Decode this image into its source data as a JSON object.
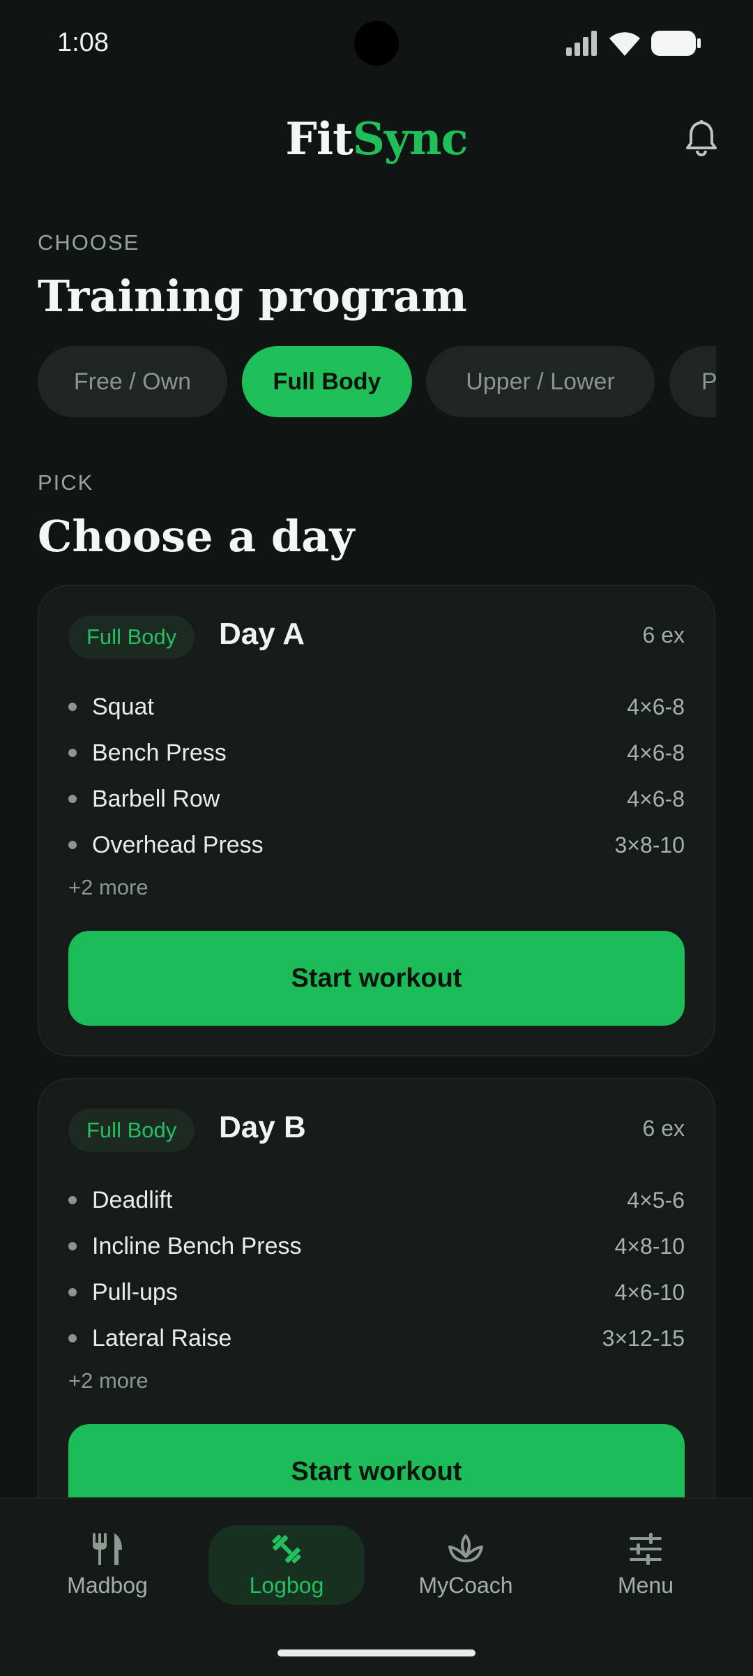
{
  "status_bar": {
    "time": "1:08"
  },
  "header": {
    "brand_part1": "Fit",
    "brand_part2": "Sync"
  },
  "program_section": {
    "eyebrow": "CHOOSE",
    "title": "Training program",
    "chips": [
      {
        "label": "Free / Own",
        "active": false
      },
      {
        "label": "Full Body",
        "active": true
      },
      {
        "label": "Upper / Lower",
        "active": false
      },
      {
        "label": "P",
        "active": false
      }
    ]
  },
  "day_section": {
    "eyebrow": "PICK",
    "title": "Choose a day",
    "days": [
      {
        "badge": "Full Body",
        "title": "Day A",
        "count": "6 ex",
        "exercises": [
          {
            "name": "Squat",
            "sets": "4×6-8"
          },
          {
            "name": "Bench Press",
            "sets": "4×6-8"
          },
          {
            "name": "Barbell Row",
            "sets": "4×6-8"
          },
          {
            "name": "Overhead Press",
            "sets": "3×8-10"
          }
        ],
        "more": "+2 more",
        "button": "Start workout"
      },
      {
        "badge": "Full Body",
        "title": "Day B",
        "count": "6 ex",
        "exercises": [
          {
            "name": "Deadlift",
            "sets": "4×5-6"
          },
          {
            "name": "Incline Bench Press",
            "sets": "4×8-10"
          },
          {
            "name": "Pull-ups",
            "sets": "4×6-10"
          },
          {
            "name": "Lateral Raise",
            "sets": "3×12-15"
          }
        ],
        "more": "+2 more",
        "button": "Start workout"
      }
    ]
  },
  "bottom_nav": {
    "items": [
      {
        "label": "Madbog",
        "icon": "fork-knife-icon",
        "active": false
      },
      {
        "label": "Logbog",
        "icon": "dumbbell-icon",
        "active": true
      },
      {
        "label": "MyCoach",
        "icon": "leaf-lotus-icon",
        "active": false
      },
      {
        "label": "Menu",
        "icon": "sliders-icon",
        "active": false
      }
    ]
  },
  "colors": {
    "background": "#0f1512",
    "accent": "#1fbf5a",
    "card": "#151b18",
    "chip_inactive": "#1f2622"
  }
}
